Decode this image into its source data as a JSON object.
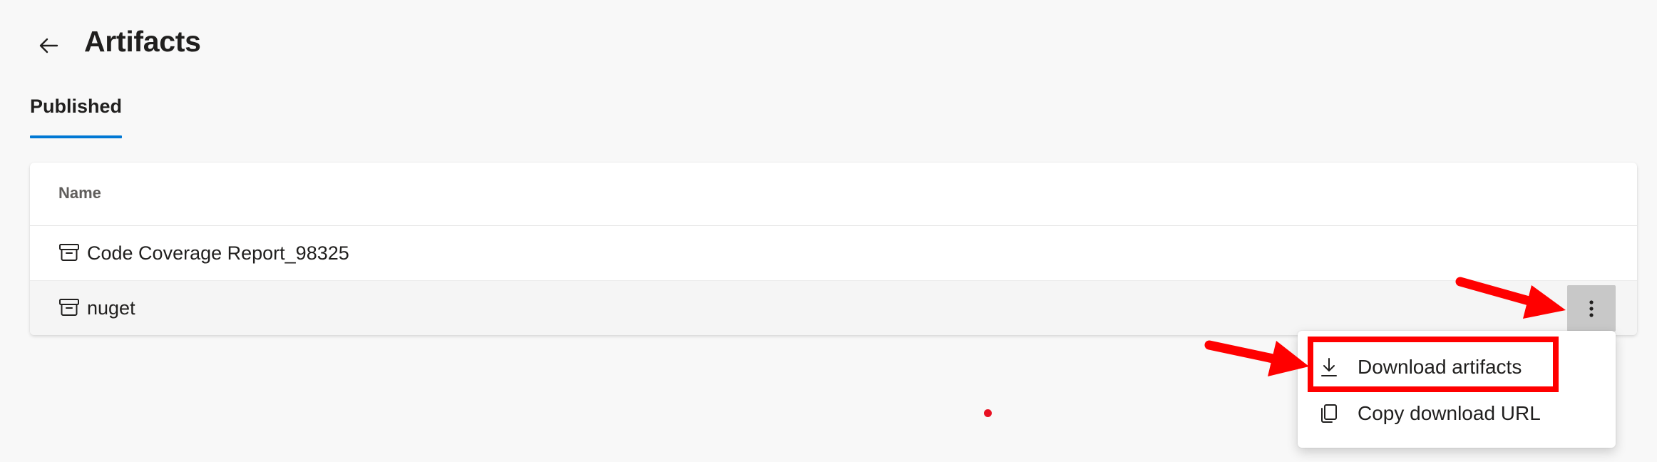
{
  "page": {
    "title": "Artifacts",
    "back_icon": "arrow-left-icon"
  },
  "tabs": [
    {
      "label": "Published",
      "selected": true
    }
  ],
  "table": {
    "columns": [
      "Name"
    ],
    "rows": [
      {
        "icon": "archive-icon",
        "name": "Code Coverage Report_98325"
      },
      {
        "icon": "archive-icon",
        "name": "nuget"
      }
    ]
  },
  "row_actions": {
    "more_icon": "more-vertical-icon"
  },
  "context_menu": {
    "items": [
      {
        "icon": "download-icon",
        "label": "Download artifacts",
        "highlighted": true
      },
      {
        "icon": "copy-icon",
        "label": "Copy download URL"
      }
    ]
  },
  "colors": {
    "accent": "#0078d4",
    "annotation": "#ff0000",
    "background": "#f8f8f8"
  }
}
